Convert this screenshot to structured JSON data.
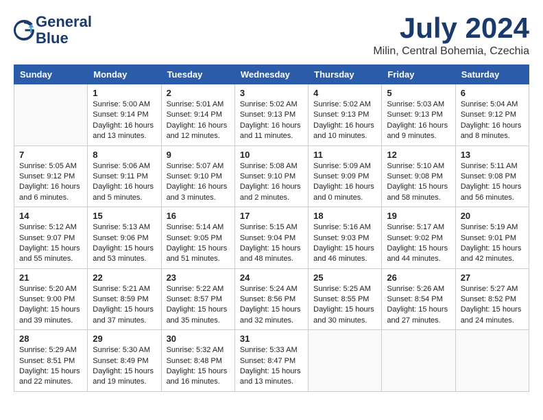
{
  "header": {
    "logo_line1": "General",
    "logo_line2": "Blue",
    "month_year": "July 2024",
    "location": "Milin, Central Bohemia, Czechia"
  },
  "days_of_week": [
    "Sunday",
    "Monday",
    "Tuesday",
    "Wednesday",
    "Thursday",
    "Friday",
    "Saturday"
  ],
  "weeks": [
    [
      {
        "day": "",
        "sunrise": "",
        "sunset": "",
        "daylight": ""
      },
      {
        "day": "1",
        "sunrise": "Sunrise: 5:00 AM",
        "sunset": "Sunset: 9:14 PM",
        "daylight": "Daylight: 16 hours and 13 minutes."
      },
      {
        "day": "2",
        "sunrise": "Sunrise: 5:01 AM",
        "sunset": "Sunset: 9:14 PM",
        "daylight": "Daylight: 16 hours and 12 minutes."
      },
      {
        "day": "3",
        "sunrise": "Sunrise: 5:02 AM",
        "sunset": "Sunset: 9:13 PM",
        "daylight": "Daylight: 16 hours and 11 minutes."
      },
      {
        "day": "4",
        "sunrise": "Sunrise: 5:02 AM",
        "sunset": "Sunset: 9:13 PM",
        "daylight": "Daylight: 16 hours and 10 minutes."
      },
      {
        "day": "5",
        "sunrise": "Sunrise: 5:03 AM",
        "sunset": "Sunset: 9:13 PM",
        "daylight": "Daylight: 16 hours and 9 minutes."
      },
      {
        "day": "6",
        "sunrise": "Sunrise: 5:04 AM",
        "sunset": "Sunset: 9:12 PM",
        "daylight": "Daylight: 16 hours and 8 minutes."
      }
    ],
    [
      {
        "day": "7",
        "sunrise": "Sunrise: 5:05 AM",
        "sunset": "Sunset: 9:12 PM",
        "daylight": "Daylight: 16 hours and 6 minutes."
      },
      {
        "day": "8",
        "sunrise": "Sunrise: 5:06 AM",
        "sunset": "Sunset: 9:11 PM",
        "daylight": "Daylight: 16 hours and 5 minutes."
      },
      {
        "day": "9",
        "sunrise": "Sunrise: 5:07 AM",
        "sunset": "Sunset: 9:10 PM",
        "daylight": "Daylight: 16 hours and 3 minutes."
      },
      {
        "day": "10",
        "sunrise": "Sunrise: 5:08 AM",
        "sunset": "Sunset: 9:10 PM",
        "daylight": "Daylight: 16 hours and 2 minutes."
      },
      {
        "day": "11",
        "sunrise": "Sunrise: 5:09 AM",
        "sunset": "Sunset: 9:09 PM",
        "daylight": "Daylight: 16 hours and 0 minutes."
      },
      {
        "day": "12",
        "sunrise": "Sunrise: 5:10 AM",
        "sunset": "Sunset: 9:08 PM",
        "daylight": "Daylight: 15 hours and 58 minutes."
      },
      {
        "day": "13",
        "sunrise": "Sunrise: 5:11 AM",
        "sunset": "Sunset: 9:08 PM",
        "daylight": "Daylight: 15 hours and 56 minutes."
      }
    ],
    [
      {
        "day": "14",
        "sunrise": "Sunrise: 5:12 AM",
        "sunset": "Sunset: 9:07 PM",
        "daylight": "Daylight: 15 hours and 55 minutes."
      },
      {
        "day": "15",
        "sunrise": "Sunrise: 5:13 AM",
        "sunset": "Sunset: 9:06 PM",
        "daylight": "Daylight: 15 hours and 53 minutes."
      },
      {
        "day": "16",
        "sunrise": "Sunrise: 5:14 AM",
        "sunset": "Sunset: 9:05 PM",
        "daylight": "Daylight: 15 hours and 51 minutes."
      },
      {
        "day": "17",
        "sunrise": "Sunrise: 5:15 AM",
        "sunset": "Sunset: 9:04 PM",
        "daylight": "Daylight: 15 hours and 48 minutes."
      },
      {
        "day": "18",
        "sunrise": "Sunrise: 5:16 AM",
        "sunset": "Sunset: 9:03 PM",
        "daylight": "Daylight: 15 hours and 46 minutes."
      },
      {
        "day": "19",
        "sunrise": "Sunrise: 5:17 AM",
        "sunset": "Sunset: 9:02 PM",
        "daylight": "Daylight: 15 hours and 44 minutes."
      },
      {
        "day": "20",
        "sunrise": "Sunrise: 5:19 AM",
        "sunset": "Sunset: 9:01 PM",
        "daylight": "Daylight: 15 hours and 42 minutes."
      }
    ],
    [
      {
        "day": "21",
        "sunrise": "Sunrise: 5:20 AM",
        "sunset": "Sunset: 9:00 PM",
        "daylight": "Daylight: 15 hours and 39 minutes."
      },
      {
        "day": "22",
        "sunrise": "Sunrise: 5:21 AM",
        "sunset": "Sunset: 8:59 PM",
        "daylight": "Daylight: 15 hours and 37 minutes."
      },
      {
        "day": "23",
        "sunrise": "Sunrise: 5:22 AM",
        "sunset": "Sunset: 8:57 PM",
        "daylight": "Daylight: 15 hours and 35 minutes."
      },
      {
        "day": "24",
        "sunrise": "Sunrise: 5:24 AM",
        "sunset": "Sunset: 8:56 PM",
        "daylight": "Daylight: 15 hours and 32 minutes."
      },
      {
        "day": "25",
        "sunrise": "Sunrise: 5:25 AM",
        "sunset": "Sunset: 8:55 PM",
        "daylight": "Daylight: 15 hours and 30 minutes."
      },
      {
        "day": "26",
        "sunrise": "Sunrise: 5:26 AM",
        "sunset": "Sunset: 8:54 PM",
        "daylight": "Daylight: 15 hours and 27 minutes."
      },
      {
        "day": "27",
        "sunrise": "Sunrise: 5:27 AM",
        "sunset": "Sunset: 8:52 PM",
        "daylight": "Daylight: 15 hours and 24 minutes."
      }
    ],
    [
      {
        "day": "28",
        "sunrise": "Sunrise: 5:29 AM",
        "sunset": "Sunset: 8:51 PM",
        "daylight": "Daylight: 15 hours and 22 minutes."
      },
      {
        "day": "29",
        "sunrise": "Sunrise: 5:30 AM",
        "sunset": "Sunset: 8:49 PM",
        "daylight": "Daylight: 15 hours and 19 minutes."
      },
      {
        "day": "30",
        "sunrise": "Sunrise: 5:32 AM",
        "sunset": "Sunset: 8:48 PM",
        "daylight": "Daylight: 15 hours and 16 minutes."
      },
      {
        "day": "31",
        "sunrise": "Sunrise: 5:33 AM",
        "sunset": "Sunset: 8:47 PM",
        "daylight": "Daylight: 15 hours and 13 minutes."
      },
      {
        "day": "",
        "sunrise": "",
        "sunset": "",
        "daylight": ""
      },
      {
        "day": "",
        "sunrise": "",
        "sunset": "",
        "daylight": ""
      },
      {
        "day": "",
        "sunrise": "",
        "sunset": "",
        "daylight": ""
      }
    ]
  ]
}
